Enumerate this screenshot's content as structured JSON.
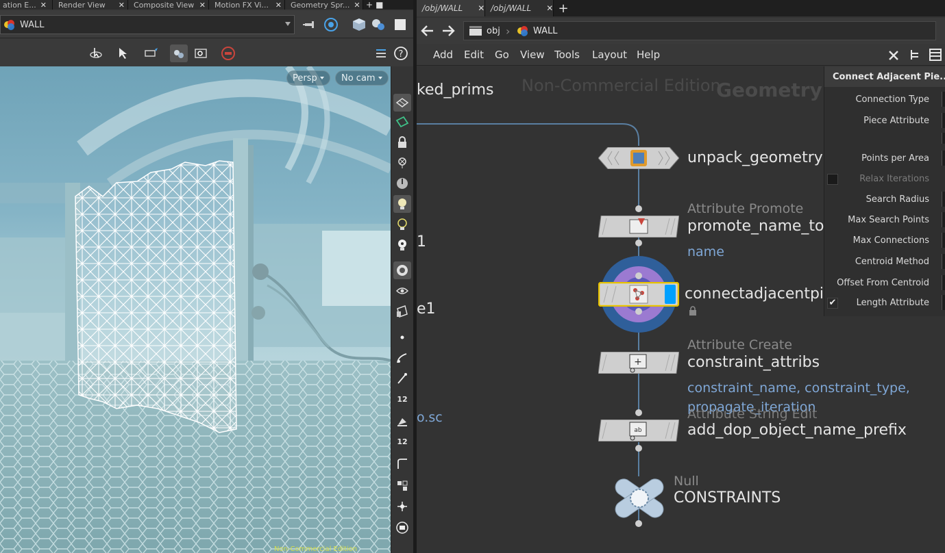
{
  "left_panel": {
    "tabs": [
      {
        "label": "ation E..."
      },
      {
        "label": "Render View"
      },
      {
        "label": "Composite View"
      },
      {
        "label": "Motion FX Vi..."
      },
      {
        "label": "Geometry Spr..."
      }
    ],
    "object_path": "WALL",
    "viewport": {
      "persp_label": "Persp",
      "camera_label": "No cam",
      "corner_text": "Non-Commercial Edition"
    },
    "side_tools": {
      "snap_number_1": "12",
      "snap_number_2": "12"
    }
  },
  "right_panel": {
    "tabs": [
      {
        "label": "/obj/WALL"
      },
      {
        "label": "/obj/WALL"
      }
    ],
    "breadcrumb": [
      {
        "label": "obj"
      },
      {
        "label": "WALL"
      }
    ],
    "menu": [
      {
        "label": "Add"
      },
      {
        "label": "Edit"
      },
      {
        "label": "Go"
      },
      {
        "label": "View"
      },
      {
        "label": "Tools"
      },
      {
        "label": "Layout"
      },
      {
        "label": "Help"
      }
    ],
    "network": {
      "watermark_edition": "Non-Commercial Edition",
      "watermark_context": "Geometry",
      "left_cut_texts": [
        "ked_prims",
        "1",
        "e1",
        "o.sc"
      ],
      "nodes": [
        {
          "type": "",
          "name": "unpack_geometry",
          "info": "",
          "icon": "unpack-icon"
        },
        {
          "type": "Attribute Promote",
          "name": "promote_name_to_",
          "info": "name",
          "icon": "attribute-promote-icon"
        },
        {
          "type": "",
          "name": "connectadjacentpie",
          "info": "",
          "icon": "connect-adjacent-pieces-icon"
        },
        {
          "type": "Attribute Create",
          "name": "constraint_attribs",
          "info": "constraint_name, constraint_type,",
          "info2": "propagate_iteration",
          "icon": "attribute-create-icon"
        },
        {
          "type": "Attribute String Edit",
          "name": "add_dop_object_name_prefix",
          "info": "",
          "icon": "attribute-string-edit-icon"
        },
        {
          "type": "Null",
          "name": "CONSTRAINTS",
          "info": "",
          "icon": "null-icon"
        }
      ]
    },
    "parameters": {
      "title": "Connect Adjacent Pie...",
      "rows": [
        {
          "label": "Connection Type",
          "enabled": true
        },
        {
          "label": "Piece Attribute",
          "enabled": true
        },
        {
          "label": "Points per Area",
          "enabled": true
        },
        {
          "label": "Relax Iterations",
          "enabled": false
        },
        {
          "label": "Search Radius",
          "enabled": true
        },
        {
          "label": "Max Search Points",
          "enabled": true
        },
        {
          "label": "Max Connections",
          "enabled": true
        },
        {
          "label": "Centroid Method",
          "enabled": true
        },
        {
          "label": "Offset From Centroid",
          "enabled": true
        },
        {
          "label": "Length Attribute",
          "enabled": true
        }
      ],
      "accent": "#00a0ff",
      "selected_outline": "#e6c200"
    }
  }
}
